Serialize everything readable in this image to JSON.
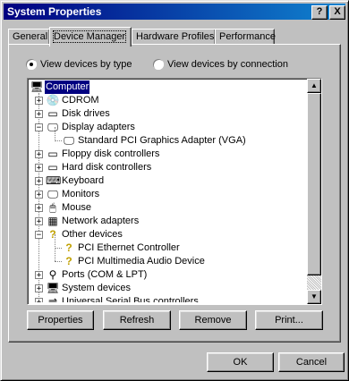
{
  "window": {
    "title": "System Properties"
  },
  "titlebar": {
    "help": "?",
    "close": "X"
  },
  "tabs": [
    "General",
    "Device Manager",
    "Hardware Profiles",
    "Performance"
  ],
  "view_options": {
    "by_type": "View devices by type",
    "by_connection": "View devices by connection",
    "selected": "by_type"
  },
  "tree": {
    "items": [
      {
        "label": "Computer",
        "icon": "computer-icon",
        "expander": "",
        "selected": true
      },
      {
        "label": "CDROM",
        "icon": "cdrom-icon",
        "expander": "+"
      },
      {
        "label": "Disk drives",
        "icon": "disk-drive-icon",
        "expander": "+"
      },
      {
        "label": "Display adapters",
        "icon": "monitor-icon",
        "expander": "−"
      },
      {
        "label": "Standard PCI Graphics Adapter (VGA)",
        "icon": "display-adapter-icon",
        "expander": ""
      },
      {
        "label": "Floppy disk controllers",
        "icon": "floppy-controller-icon",
        "expander": "+"
      },
      {
        "label": "Hard disk controllers",
        "icon": "hard-disk-controller-icon",
        "expander": "+"
      },
      {
        "label": "Keyboard",
        "icon": "keyboard-icon",
        "expander": "+"
      },
      {
        "label": "Monitors",
        "icon": "monitor-icon",
        "expander": "+"
      },
      {
        "label": "Mouse",
        "icon": "mouse-icon",
        "expander": "+"
      },
      {
        "label": "Network adapters",
        "icon": "network-adapter-icon",
        "expander": "+"
      },
      {
        "label": "Other devices",
        "icon": "question-device-icon",
        "expander": "−"
      },
      {
        "label": "PCI Ethernet Controller",
        "icon": "question-device-icon",
        "expander": ""
      },
      {
        "label": "PCI Multimedia Audio Device",
        "icon": "question-device-icon",
        "expander": ""
      },
      {
        "label": "Ports (COM & LPT)",
        "icon": "port-icon",
        "expander": "+"
      },
      {
        "label": "System devices",
        "icon": "computer-icon",
        "expander": "+"
      },
      {
        "label": "Universal Serial Bus controllers",
        "icon": "usb-icon",
        "expander": "+"
      }
    ]
  },
  "buttons": {
    "properties": "Properties",
    "refresh": "Refresh",
    "remove": "Remove",
    "print": "Print...",
    "ok": "OK",
    "cancel": "Cancel"
  },
  "colors": {
    "title_bar": "#000080",
    "selection": "#000080",
    "face": "#c0c0c0"
  }
}
